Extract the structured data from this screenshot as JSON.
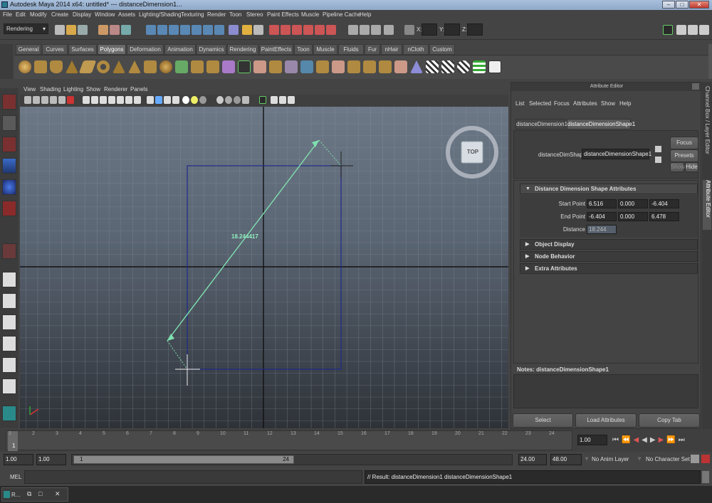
{
  "window": {
    "title": "Autodesk Maya 2014 x64: untitled*    ---    distanceDimension1...",
    "min_label": "–",
    "max_label": "□",
    "close_label": "✕"
  },
  "menus": [
    "File",
    "Edit",
    "Modify",
    "Create",
    "Display",
    "Window",
    "Assets",
    "Lighting/Shading",
    "Texturing",
    "Render",
    "Toon",
    "Stereo",
    "Paint Effects",
    "Muscle",
    "Pipeline Cache",
    "Help"
  ],
  "status_line": {
    "mode_dropdown": "Rendering",
    "x_label": "X:",
    "y_label": "Y:",
    "z_label": "Z:"
  },
  "shelf_tabs": [
    "General",
    "Curves",
    "Surfaces",
    "Polygons",
    "Deformation",
    "Animation",
    "Dynamics",
    "Rendering",
    "PaintEffects",
    "Toon",
    "Muscle",
    "Fluids",
    "Fur",
    "nHair",
    "nCloth",
    "Custom"
  ],
  "shelf_active_tab": "Polygons",
  "viewport": {
    "menus": [
      "View",
      "Shading",
      "Lighting",
      "Show",
      "Renderer",
      "Panels"
    ],
    "measure_label": "18.244417",
    "viewcube_label": "TOP"
  },
  "attr_editor": {
    "title": "Attribute Editor",
    "menus": [
      "List",
      "Selected",
      "Focus",
      "Attributes",
      "Show",
      "Help"
    ],
    "tabs": [
      "distanceDimension1",
      "distanceDimensionShape1"
    ],
    "active_tab": "distanceDimensionShape1",
    "node_label": "distanceDimShape:",
    "node_value": "distanceDimensionShape1",
    "focus_btn": "Focus",
    "presets_btn": "Presets",
    "show_btn": "Show",
    "hide_btn": "Hide",
    "section_main": "Distance Dimension Shape Attributes",
    "start_point_label": "Start Point",
    "start_point": [
      "6.516",
      "0.000",
      "-6.404"
    ],
    "end_point_label": "End Point",
    "end_point": [
      "-6.404",
      "0.000",
      "6.478"
    ],
    "distance_label": "Distance",
    "distance_value": "18.244",
    "sections": [
      "Object Display",
      "Node Behavior",
      "Extra Attributes"
    ],
    "notes_label": "Notes:  distanceDimensionShape1",
    "select_btn": "Select",
    "load_btn": "Load Attributes",
    "copy_btn": "Copy Tab"
  },
  "side_tabs": {
    "channel_box": "Channel Box / Layer Editor",
    "attribute_editor": "Attribute Editor"
  },
  "time_slider": {
    "ticks": [
      "1",
      "2",
      "3",
      "4",
      "5",
      "6",
      "7",
      "8",
      "9",
      "10",
      "11",
      "12",
      "13",
      "14",
      "15",
      "16",
      "17",
      "18",
      "19",
      "20",
      "21",
      "22",
      "23",
      "24"
    ],
    "current_frame_field": "1",
    "current_time": "1.00"
  },
  "range_slider": {
    "start": "1.00",
    "playback_start": "1.00",
    "range_start_label": "1",
    "range_end_label": "24",
    "playback_end": "24.00",
    "end": "48.00",
    "anim_layer": "No Anim Layer",
    "character_set": "No Character Set"
  },
  "command_line": {
    "mel_label": "MEL",
    "result": "// Result: distanceDimension1 distanceDimensionShape1"
  },
  "taskbar": {
    "item_label": "R..."
  }
}
